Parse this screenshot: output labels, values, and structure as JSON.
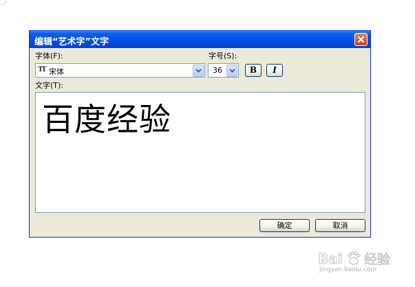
{
  "dialog": {
    "title": "编辑“艺术字”文字",
    "close_icon": "close-icon"
  },
  "font": {
    "label": "字体(F):",
    "value": "宋体",
    "icon": "truetype-font-icon",
    "icon_glyph": "TT"
  },
  "size": {
    "label": "字号(S):",
    "value": "36"
  },
  "format": {
    "bold_label": "B",
    "italic_label": "I"
  },
  "text": {
    "label": "文字(T):",
    "value": "百度经验"
  },
  "buttons": {
    "ok_label": "确定",
    "cancel_label": "取消"
  },
  "watermark": {
    "brand": "Bai",
    "brand_suffix": "经验",
    "url": "jingyan.baidu.com"
  },
  "colors": {
    "titlebar": "#0554e3",
    "dialog_bg": "#ece9d8",
    "close_button": "#d85a3a"
  }
}
